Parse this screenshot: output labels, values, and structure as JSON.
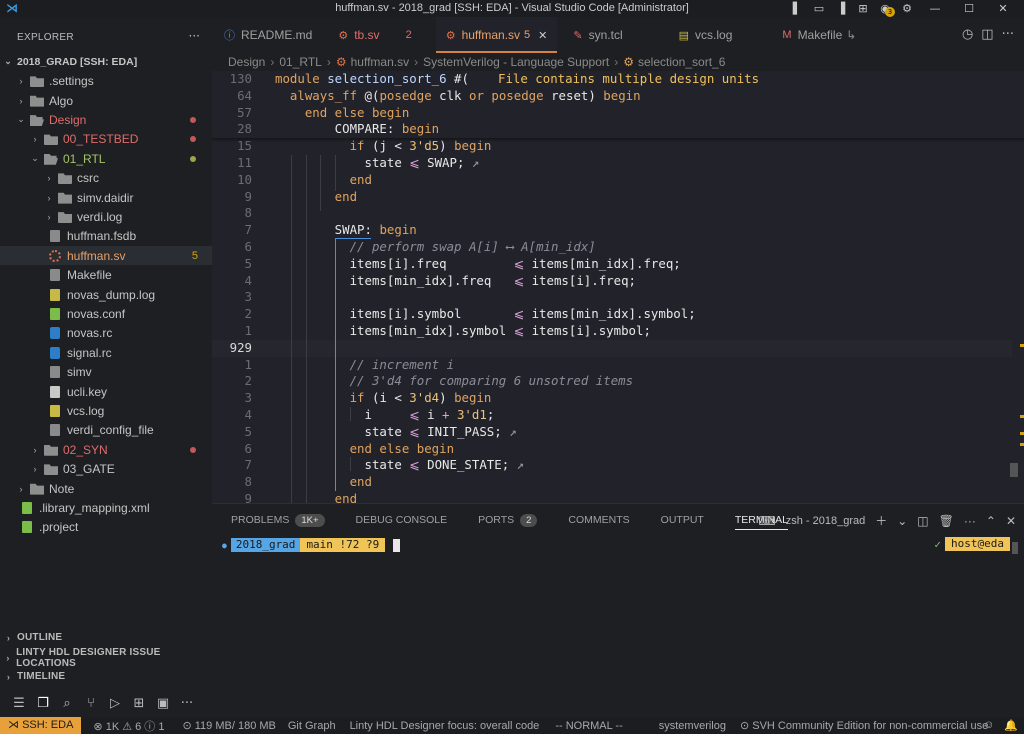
{
  "window": {
    "title": "huffman.sv - 2018_grad [SSH: EDA] - Visual Studio Code [Administrator]",
    "notification_count": "3"
  },
  "sidebar": {
    "header": "EXPLORER",
    "more": "···",
    "root": "2018_GRAD [SSH: EDA]",
    "items": [
      {
        "label": ".settings"
      },
      {
        "label": "Algo"
      },
      {
        "label": "Design"
      },
      {
        "label": "00_TESTBED"
      },
      {
        "label": "01_RTL"
      },
      {
        "label": "csrc"
      },
      {
        "label": "simv.daidir"
      },
      {
        "label": "verdi.log"
      },
      {
        "label": "huffman.fsdb"
      },
      {
        "label": "huffman.sv",
        "count": "5"
      },
      {
        "label": "Makefile"
      },
      {
        "label": "novas_dump.log"
      },
      {
        "label": "novas.conf"
      },
      {
        "label": "novas.rc"
      },
      {
        "label": "signal.rc"
      },
      {
        "label": "simv"
      },
      {
        "label": "ucli.key"
      },
      {
        "label": "vcs.log"
      },
      {
        "label": "verdi_config_file"
      },
      {
        "label": "02_SYN"
      },
      {
        "label": "03_GATE"
      },
      {
        "label": "Note"
      },
      {
        "label": ".library_mapping.xml"
      },
      {
        "label": ".project"
      }
    ],
    "sections": [
      "OUTLINE",
      "LINTY HDL DESIGNER ISSUE LOCATIONS",
      "TIMELINE"
    ]
  },
  "tabs": [
    {
      "label": "README.md"
    },
    {
      "label": "tb.sv",
      "count": "2"
    },
    {
      "label": "huffman.sv",
      "count": "5"
    },
    {
      "label": "syn.tcl"
    },
    {
      "label": "vcs.log"
    },
    {
      "label": "Makefile"
    }
  ],
  "breadcrumb": [
    "Design",
    "01_RTL",
    "huffman.sv",
    "SystemVerilog - Language Support",
    "selection_sort_6"
  ],
  "editor": {
    "diagnostic": "File contains multiple design units",
    "lines": [
      {
        "ln": "130",
        "tokens": [
          [
            "kw",
            "module "
          ],
          [
            "fn",
            "selection_sort_6"
          ],
          [
            "id",
            " #("
          ]
        ]
      },
      {
        "ln": "64",
        "tokens": [
          [
            "kw",
            "  always_ff "
          ],
          [
            "id",
            "@("
          ],
          [
            "kw",
            "posedge "
          ],
          [
            "id",
            "clk "
          ],
          [
            "kw",
            "or "
          ],
          [
            "kw",
            "posedge "
          ],
          [
            "id",
            "reset) "
          ],
          [
            "kw",
            "begin"
          ]
        ]
      },
      {
        "ln": "57",
        "tokens": [
          [
            "kw",
            "    end else begin"
          ]
        ]
      },
      {
        "ln": "28",
        "tokens": [
          [
            "id",
            "        COMPARE: "
          ],
          [
            "kw",
            "begin"
          ]
        ]
      },
      {
        "ln": "15",
        "tokens": [
          [
            "kw",
            "          if "
          ],
          [
            "id",
            "(j < "
          ],
          [
            "num",
            "3'd5"
          ],
          [
            "id",
            ") "
          ],
          [
            "kw",
            "begin"
          ]
        ]
      },
      {
        "ln": "11",
        "tokens": [
          [
            "id",
            "            state "
          ],
          [
            "op",
            "⩽ "
          ],
          [
            "id",
            "SWAP; "
          ],
          [
            "hint",
            "↗"
          ]
        ]
      },
      {
        "ln": "10",
        "tokens": [
          [
            "kw",
            "          end"
          ]
        ]
      },
      {
        "ln": "9",
        "tokens": [
          [
            "kw",
            "        end"
          ]
        ]
      },
      {
        "ln": "8",
        "tokens": []
      },
      {
        "ln": "7",
        "tokens": [
          [
            "id",
            "        SWAP: "
          ],
          [
            "kw",
            "begin"
          ]
        ]
      },
      {
        "ln": "6",
        "tokens": [
          [
            "cmt",
            "          // perform swap A[i] ⟷ A[min_idx]"
          ]
        ]
      },
      {
        "ln": "5",
        "tokens": [
          [
            "id",
            "          items[i].freq         "
          ],
          [
            "op",
            "⩽ "
          ],
          [
            "id",
            "items[min_idx].freq;"
          ]
        ]
      },
      {
        "ln": "4",
        "tokens": [
          [
            "id",
            "          items[min_idx].freq   "
          ],
          [
            "op",
            "⩽ "
          ],
          [
            "id",
            "items[i].freq;"
          ]
        ]
      },
      {
        "ln": "3",
        "tokens": []
      },
      {
        "ln": "2",
        "tokens": [
          [
            "id",
            "          items[i].symbol       "
          ],
          [
            "op",
            "⩽ "
          ],
          [
            "id",
            "items[min_idx].symbol;"
          ]
        ]
      },
      {
        "ln": "1",
        "tokens": [
          [
            "id",
            "          items[min_idx].symbol "
          ],
          [
            "op",
            "⩽ "
          ],
          [
            "id",
            "items[i].symbol;"
          ]
        ]
      },
      {
        "ln": "929",
        "tokens": [],
        "current": true
      },
      {
        "ln": "1",
        "tokens": [
          [
            "cmt",
            "          // increment i"
          ]
        ]
      },
      {
        "ln": "2",
        "tokens": [
          [
            "cmt",
            "          // 3'd4 for comparing 6 unsotred items"
          ]
        ]
      },
      {
        "ln": "3",
        "tokens": [
          [
            "kw",
            "          if "
          ],
          [
            "id",
            "(i < "
          ],
          [
            "num",
            "3'd4"
          ],
          [
            "id",
            ") "
          ],
          [
            "kw",
            "begin"
          ]
        ]
      },
      {
        "ln": "4",
        "tokens": [
          [
            "id",
            "            i     "
          ],
          [
            "op",
            "⩽ "
          ],
          [
            "id",
            "i "
          ],
          [
            "op",
            "+ "
          ],
          [
            "num",
            "3'd1"
          ],
          [
            "id",
            ";"
          ]
        ]
      },
      {
        "ln": "5",
        "tokens": [
          [
            "id",
            "            state "
          ],
          [
            "op",
            "⩽ "
          ],
          [
            "id",
            "INIT_PASS; "
          ],
          [
            "hint",
            "↗"
          ]
        ]
      },
      {
        "ln": "6",
        "tokens": [
          [
            "kw",
            "          end else begin"
          ]
        ]
      },
      {
        "ln": "7",
        "tokens": [
          [
            "id",
            "            state "
          ],
          [
            "op",
            "⩽ "
          ],
          [
            "id",
            "DONE_STATE; "
          ],
          [
            "hint",
            "↗"
          ]
        ]
      },
      {
        "ln": "8",
        "tokens": [
          [
            "kw",
            "          end"
          ]
        ]
      },
      {
        "ln": "9",
        "tokens": [
          [
            "kw",
            "        end"
          ]
        ]
      }
    ]
  },
  "panel": {
    "tabs": [
      {
        "label": "PROBLEMS",
        "badge": "1K+"
      },
      {
        "label": "DEBUG CONSOLE"
      },
      {
        "label": "PORTS",
        "badge": "2"
      },
      {
        "label": "COMMENTS"
      },
      {
        "label": "OUTPUT"
      },
      {
        "label": "TERMINAL",
        "active": true
      }
    ],
    "shell": "zsh - 2018_grad",
    "prompt_dir": "2018_grad",
    "prompt_git": "main !72 ?9",
    "host_ok": "✓",
    "host": "host@eda"
  },
  "statusbar": {
    "remote": "SSH: EDA",
    "problems": "⊗ 1K ⚠ 6 ⓘ 1",
    "memory": "⊙ 119 MB/ 180 MB",
    "gitgraph": "Git Graph",
    "linty": "Linty HDL Designer focus: overall code",
    "vim": "-- NORMAL --",
    "lang": "systemverilog",
    "svh": "⊙ SVH Community Edition for non-commercial use"
  },
  "colors": {
    "accent": "#d9823f",
    "remote_bg": "#e8a13a",
    "editor_bg": "#22232a",
    "sidebar_bg": "#1e1f22"
  }
}
